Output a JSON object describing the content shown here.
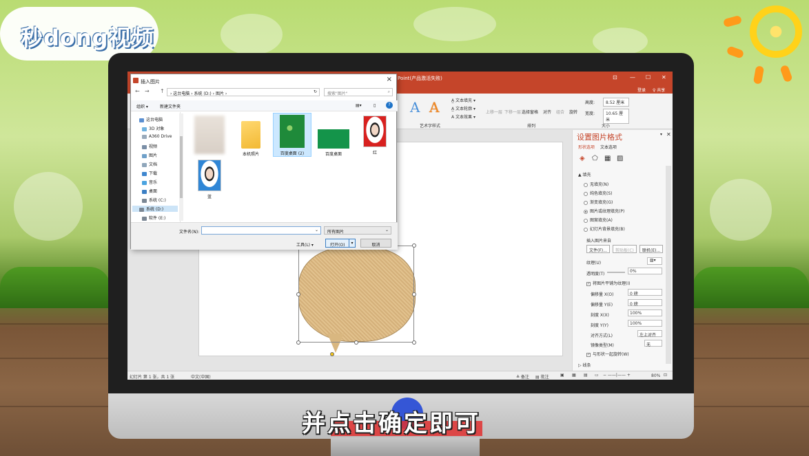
{
  "watermark": {
    "logo_text": "秒dong视频"
  },
  "ppt": {
    "title": "Point(产品激活失败)",
    "login": "登录",
    "share": "♀ 共享",
    "ribbon": {
      "text_fill": "文本填充",
      "text_outline": "文本轮廓",
      "text_effect": "文本效果",
      "art_group": "艺术字样式",
      "move_up": "上移一层",
      "move_down": "下移一层",
      "select_pane": "选择窗格",
      "align": "对齐",
      "group": "组合",
      "rotate": "旋转",
      "arrange_group": "排列",
      "height_label": "高度:",
      "height_value": "8.52 厘米",
      "width_label": "宽度:",
      "width_value": "10.65 厘米",
      "size_group": "大小"
    },
    "format_pane": {
      "title": "设置图片格式",
      "tab_shape": "形状选项",
      "tab_text": "文本选项",
      "fill_section": "▲ 填充",
      "options": [
        "无填充(N)",
        "纯色填充(S)",
        "渐变填充(G)",
        "图片或纹理填充(P)",
        "图案填充(A)",
        "幻灯片背景填充(B)"
      ],
      "insert_from": "插入图片来自",
      "btn_file": "文件(F)...",
      "btn_clipboard": "剪贴板(C)",
      "btn_online": "联机(E)...",
      "texture": "纹理(U)",
      "transparency": "透明度(T)",
      "transparency_value": "0%",
      "tile_check": "将图片平铺为纹理(I)",
      "offset_x": "偏移量 X(O)",
      "offset_x_value": "0 磅",
      "offset_y": "偏移量 Y(E)",
      "offset_y_value": "0 磅",
      "scale_x": "刻度 X(X)",
      "scale_x_value": "100%",
      "scale_y": "刻度 Y(Y)",
      "scale_y_value": "100%",
      "alignment": "对齐方式(L)",
      "alignment_value": "左上对齐",
      "mirror": "镜像类型(M)",
      "mirror_value": "无",
      "rotate_check": "与形状一起旋转(W)",
      "line_section": "▷ 线条"
    },
    "status": {
      "slide_info": "幻灯片 第 1 张，共 1 张",
      "language": "中文(中国)",
      "notes": "≜ 备注",
      "comments": "▤ 批注",
      "zoom": "80%"
    }
  },
  "dialog": {
    "title": "插入图片",
    "address": "› 这台电脑 › 系统 (D:) › 图片 ›",
    "search_placeholder": "搜索\"图片\"",
    "organize": "组织 ▾",
    "new_folder": "新建文件夹",
    "tree": [
      "这台电脑",
      "3D 对象",
      "A360 Drive",
      "视频",
      "图片",
      "文档",
      "下载",
      "音乐",
      "桌面",
      "系统 (C:)",
      "系统 (D:)",
      "软件 (E:)"
    ],
    "files": [
      "",
      "本机照片",
      "百度桌面 (2)",
      "百度桌面",
      "红",
      "蓝"
    ],
    "filename_label": "文件名(N):",
    "filetype_value": "所有图片",
    "tools": "工具(L) ▾",
    "open": "打开(O)",
    "cancel": "取消"
  },
  "subtitle": "并点击确定即可"
}
